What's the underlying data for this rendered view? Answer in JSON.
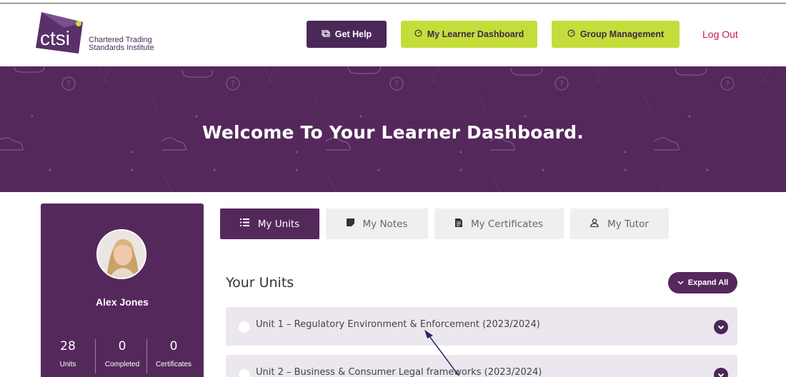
{
  "header": {
    "logo_word": "ctsi",
    "logo_line1": "Chartered Trading",
    "logo_line2": "Standards Institute",
    "get_help": "Get Help",
    "learner_dashboard": "My Learner Dashboard",
    "group_management": "Group Management",
    "logout": "Log Out"
  },
  "hero": {
    "title": "Welcome To Your Learner Dashboard."
  },
  "profile": {
    "name": "Alex Jones",
    "stats": [
      {
        "value": "28",
        "label": "Units"
      },
      {
        "value": "0",
        "label": "Completed"
      },
      {
        "value": "0",
        "label": "Certificates"
      }
    ]
  },
  "tabs": [
    {
      "label": "My Units",
      "icon": "list-icon",
      "active": true
    },
    {
      "label": "My Notes",
      "icon": "note-icon",
      "active": false
    },
    {
      "label": "My Certificates",
      "icon": "document-icon",
      "active": false
    },
    {
      "label": "My Tutor",
      "icon": "user-icon",
      "active": false
    }
  ],
  "units_section": {
    "title": "Your Units",
    "expand_all": "Expand All",
    "units": [
      {
        "title": "Unit 1 – Regulatory Environment & Enforcement (2023/2024)"
      },
      {
        "title": "Unit 2 – Business & Consumer Legal frameworks (2023/2024)"
      }
    ]
  },
  "colors": {
    "brand_purple": "#55285c",
    "accent_green": "#c5dd3a",
    "logout_red": "#c2185b"
  }
}
